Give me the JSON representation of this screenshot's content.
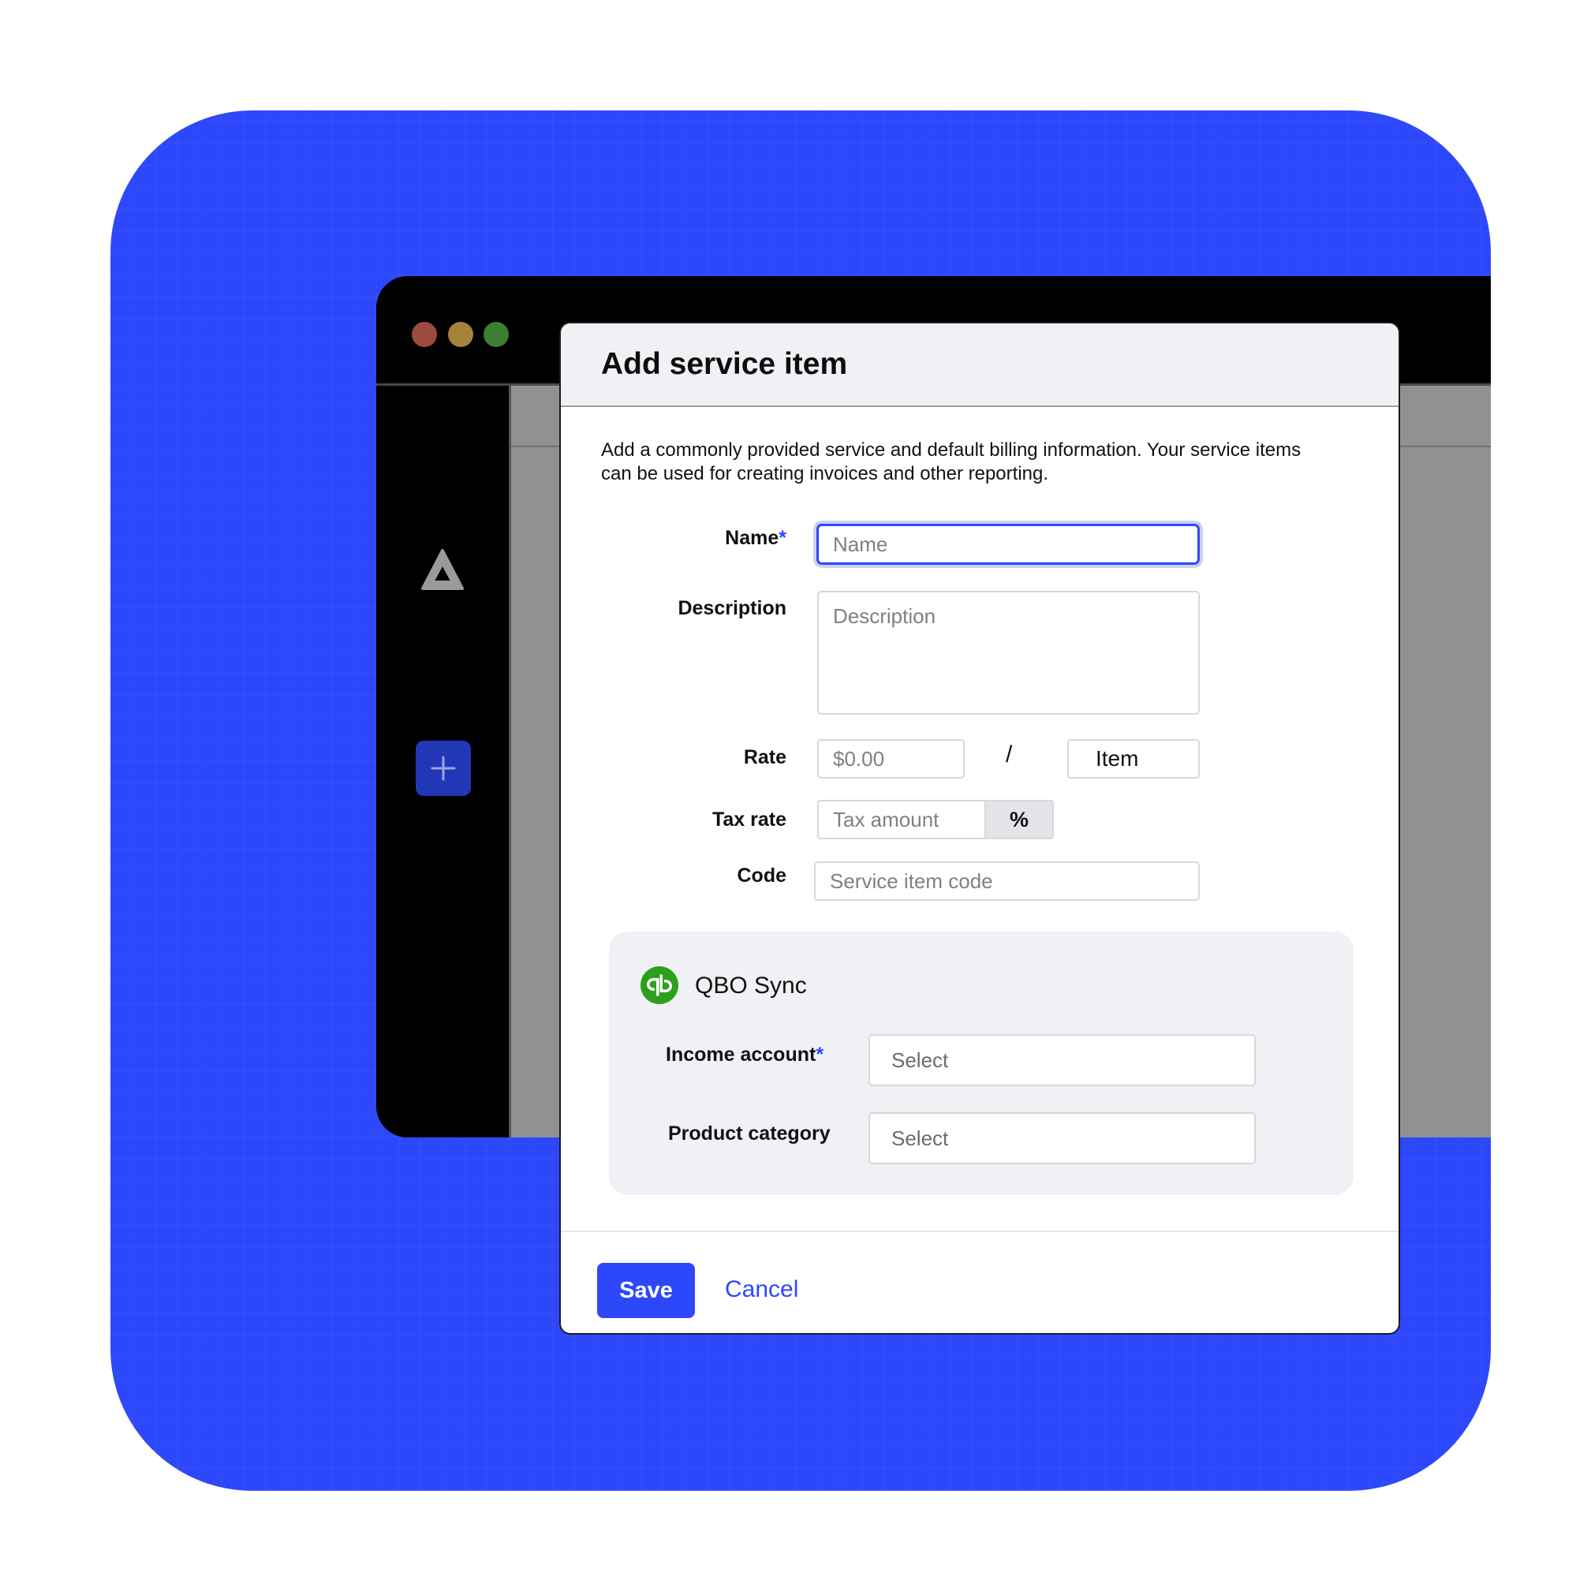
{
  "colors": {
    "brand_blue": "#2d48fb",
    "window_black": "#000000",
    "content_gray": "#909192",
    "traffic_red": "#9b4b3d",
    "traffic_yellow": "#a6823b",
    "traffic_green": "#3e7e32",
    "qbo_green": "#2ca01c"
  },
  "icons": {
    "logo": "app-logo-icon",
    "add": "plus-icon",
    "qbo": "quickbooks-icon"
  },
  "modal": {
    "title": "Add service item",
    "intro": "Add a commonly provided service and default billing information. Your service items can be used for creating invoices and other reporting.",
    "required_mark": "*",
    "fields": {
      "name": {
        "label": "Name",
        "placeholder": "Name"
      },
      "description": {
        "label": "Description",
        "placeholder": "Description"
      },
      "rate": {
        "label": "Rate",
        "placeholder": "$0.00",
        "separator": "/",
        "unit": "Item"
      },
      "tax_rate": {
        "label": "Tax rate",
        "placeholder": "Tax amount",
        "suffix": "%"
      },
      "code": {
        "label": "Code",
        "placeholder": "Service item code"
      }
    },
    "qbo": {
      "title": "QBO Sync",
      "income_account": {
        "label": "Income account",
        "value": "Select"
      },
      "product_category": {
        "label": "Product category",
        "value": "Select"
      }
    },
    "footer": {
      "save_label": "Save",
      "cancel_label": "Cancel"
    }
  }
}
